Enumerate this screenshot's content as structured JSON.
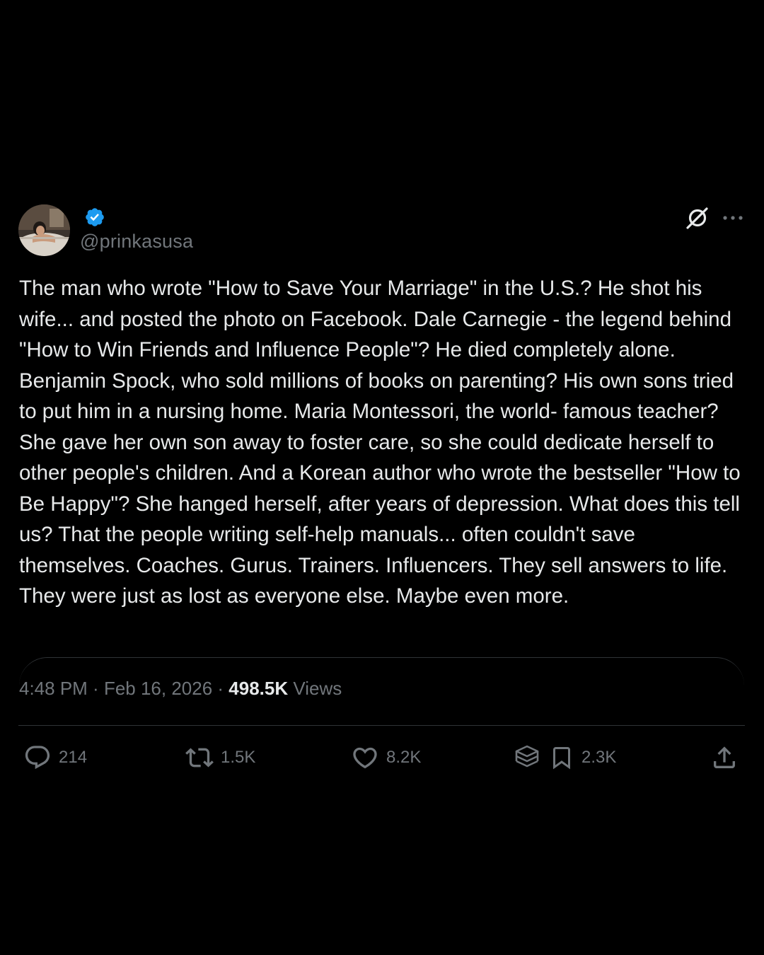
{
  "user": {
    "handle": "@prinkasusa",
    "verified": true,
    "verified_color": "#1d9bf0"
  },
  "icons": {
    "header_right": [
      "grok-icon",
      "more-icon"
    ],
    "actions": [
      "reply-icon",
      "repost-icon",
      "like-icon",
      "grok-stack-icon",
      "bookmark-icon",
      "share-icon"
    ]
  },
  "post": {
    "text": "The man who wrote \"How to Save Your Marriage\" in the U.S.? He shot his wife... and posted the photo on Facebook. Dale Carnegie - the legend behind \"How to Win Friends and Influence People\"? He died completely alone. Benjamin Spock, who sold millions of books on parenting? His own sons tried to put him in a nursing home. Maria Montessori, the world- famous teacher? She gave her own son away to foster care, so she could dedicate herself to other people's children. And a Korean author who wrote the bestseller \"How to Be Happy\"? She hanged herself, after years of depression. What does this tell us? That the people writing self-help manuals... often couldn't save themselves. Coaches. Gurus. Trainers. Influencers. They sell answers to life. They were just as lost as everyone else. Maybe even more."
  },
  "meta": {
    "time": "4:48 PM",
    "separator": " · ",
    "date": "Feb 16, 2026",
    "views_count": "498.5K",
    "views_label": " Views"
  },
  "actions": {
    "replies": "214",
    "reposts": "1.5K",
    "likes": "8.2K",
    "bookmarks": "2.3K"
  },
  "colors": {
    "background": "#000000",
    "text": "#e7e9ea",
    "secondary": "#71767b",
    "divider": "#2f3336"
  }
}
